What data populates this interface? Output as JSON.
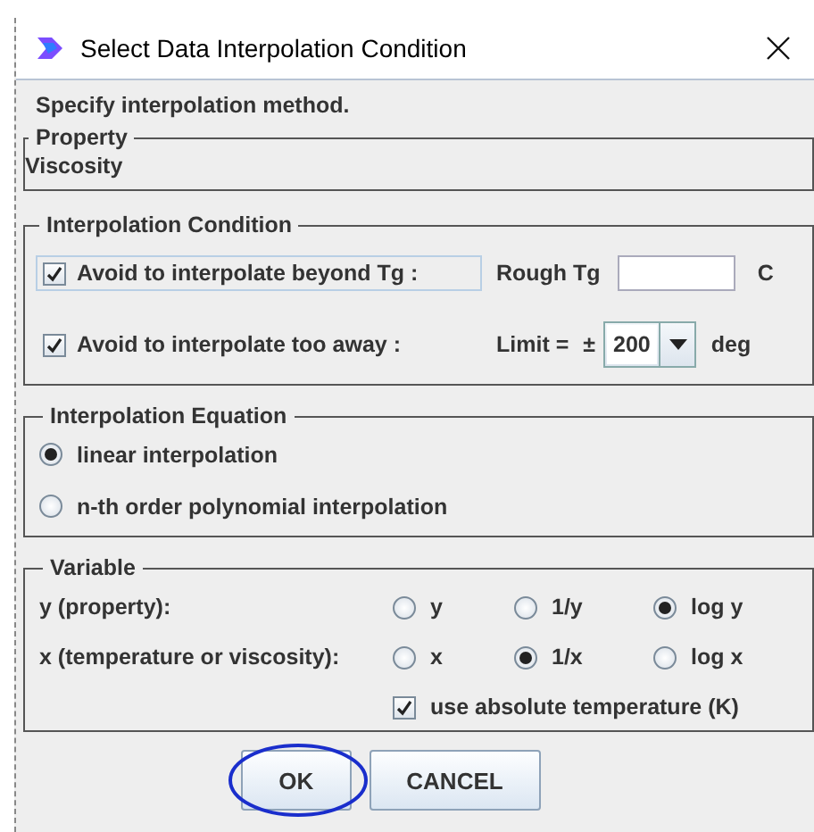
{
  "window": {
    "title": "Select Data Interpolation Condition"
  },
  "instruction": "Specify interpolation method.",
  "property": {
    "legend": "Property",
    "value": "Viscosity"
  },
  "condition": {
    "legend": "Interpolation Condition",
    "rows": [
      {
        "kind": "field",
        "label": "Avoid to interpolate beyond Tg :",
        "checked": true,
        "focused": true,
        "field_label": "Rough Tg",
        "unit": "C"
      },
      {
        "kind": "dropdown",
        "label": "Avoid to interpolate too away :",
        "checked": true,
        "focused": false,
        "field_label": "Limit =",
        "sign": "±",
        "value": "200",
        "unit": "deg"
      }
    ]
  },
  "equation": {
    "legend": "Interpolation Equation",
    "options": [
      {
        "label": "linear interpolation",
        "selected": true
      },
      {
        "label": "n-th order polynomial interpolation",
        "selected": false
      }
    ]
  },
  "variable": {
    "legend": "Variable",
    "rows": [
      {
        "label": "y (property):",
        "options": [
          {
            "label": "y",
            "selected": false
          },
          {
            "label": "1/y",
            "selected": false
          },
          {
            "label": "log y",
            "selected": true
          }
        ]
      },
      {
        "label": "x (temperature or viscosity):",
        "options": [
          {
            "label": "x",
            "selected": false
          },
          {
            "label": "1/x",
            "selected": true
          },
          {
            "label": "log x",
            "selected": false
          }
        ]
      }
    ],
    "absolute": {
      "label": "use absolute temperature (K)",
      "checked": true
    }
  },
  "buttons": [
    {
      "label": "OK",
      "circled": true
    },
    {
      "label": "CANCEL",
      "circled": false
    }
  ]
}
